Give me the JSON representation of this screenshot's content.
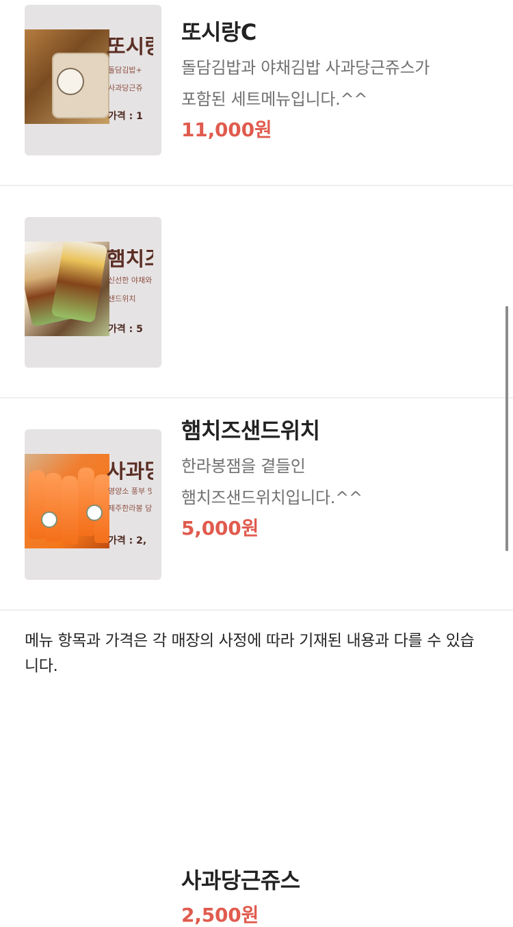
{
  "menu": {
    "items": [
      {
        "title": "또시랑C",
        "description_line1": "돌담김밥과 야채김밥 사과당근쥬스가",
        "description_line2": "포함된 세트메뉴입니다.^^",
        "price": "11,000원",
        "thumbnail": {
          "script_title": "또시랑",
          "line1": "돌담김밥+",
          "line2": "사과당근쥬",
          "price_label": "가격 : 1",
          "icon": "bento-box-icon"
        }
      },
      {
        "title": "햄치즈샌드위치",
        "description_line1": "한라봉잼을 곁들인",
        "description_line2": "햄치즈샌드위치입니다.^^",
        "price": "5,000원",
        "thumbnail": {
          "script_title": "햄치즈",
          "line1": "신선한 야채와",
          "line2": "샌드위치",
          "price_label": "가격 : 5",
          "icon": "sandwich-icon"
        }
      },
      {
        "title": "사과당근쥬스",
        "price": "2,500원",
        "thumbnail": {
          "script_title": "사과당",
          "line1": "영양소 풍부 맛있",
          "line2": "제주한라봉 당근",
          "price_label": "가격 : 2,",
          "icon": "juice-bottle-icon"
        }
      }
    ]
  },
  "notice": "메뉴 항목과 가격은 각 매장의 사정에 따라 기재된 내용과 다를 수 있습니다."
}
